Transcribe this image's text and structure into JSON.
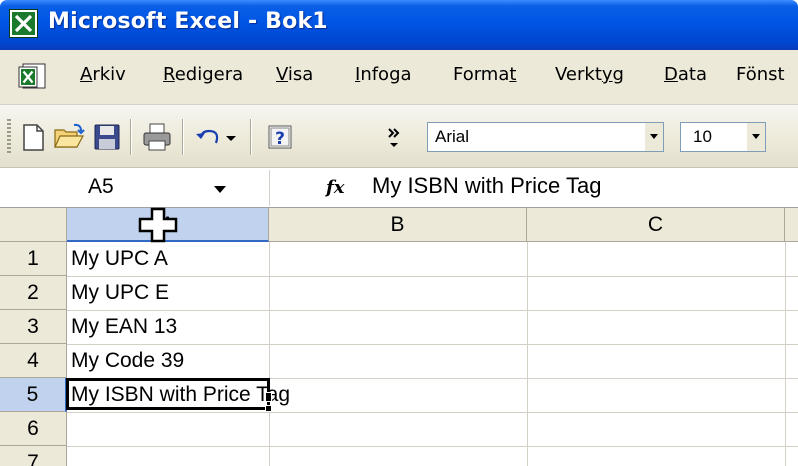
{
  "window": {
    "title": "Microsoft Excel - Bok1",
    "app_icon": "excel-icon"
  },
  "menu": {
    "items": [
      {
        "label": "Arkiv",
        "accel": "A"
      },
      {
        "label": "Redigera",
        "accel": "R"
      },
      {
        "label": "Visa",
        "accel": "V"
      },
      {
        "label": "Infoga",
        "accel": "I"
      },
      {
        "label": "Format",
        "accel": "t"
      },
      {
        "label": "Verktyg",
        "accel": "y"
      },
      {
        "label": "Data",
        "accel": "D"
      },
      {
        "label": "Fönst",
        "accel": ""
      }
    ]
  },
  "toolbar": {
    "icons": [
      "new-document-icon",
      "open-folder-icon",
      "save-icon",
      "print-icon",
      "undo-icon",
      "help-icon",
      "more-buttons-icon"
    ],
    "font_name": "Arial",
    "font_size": "10"
  },
  "formula_bar": {
    "name_box": "A5",
    "fx_label": "fx",
    "content": "My ISBN with Price Tag"
  },
  "sheet": {
    "columns": [
      "A",
      "B",
      "C"
    ],
    "rows": [
      {
        "num": "1",
        "a": "My UPC A"
      },
      {
        "num": "2",
        "a": "My UPC E"
      },
      {
        "num": "3",
        "a": "My EAN 13"
      },
      {
        "num": "4",
        "a": "My Code 39"
      },
      {
        "num": "5",
        "a": "My ISBN with Price Tag"
      },
      {
        "num": "6",
        "a": ""
      },
      {
        "num": "7",
        "a": ""
      }
    ],
    "selected_column": "A",
    "selected_row": "5"
  },
  "colors": {
    "title_bar": "#0055e5",
    "chrome": "#ece9d8",
    "selection_header": "#c1d2ee",
    "selection_accent": "#316ac5"
  }
}
